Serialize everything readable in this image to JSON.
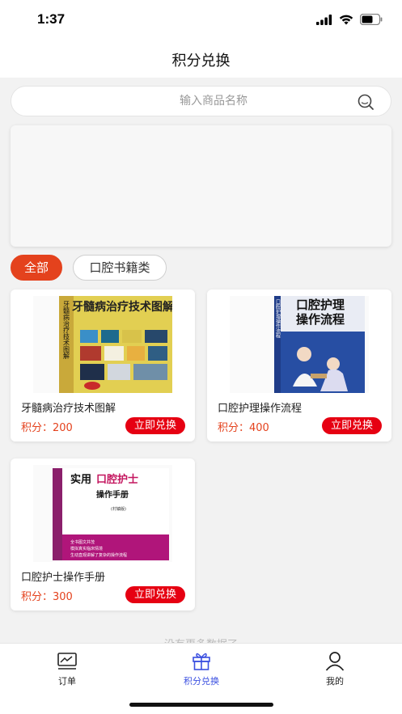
{
  "status_bar": {
    "time": "1:37"
  },
  "nav": {
    "title": "积分兑换"
  },
  "search": {
    "placeholder": "输入商品名称"
  },
  "categories": [
    {
      "label": "全部",
      "active": true
    },
    {
      "label": "口腔书籍类",
      "active": false
    }
  ],
  "products": [
    {
      "name": "牙髓病治疗技术图解",
      "points": "积分：200",
      "button": "立即兑换",
      "cover_title": "牙髓病治疗技术图解",
      "cover_spine": "牙髓病治疗技术图解"
    },
    {
      "name": "口腔护理操作流程",
      "points": "积分：400",
      "button": "立即兑换",
      "cover_title_line1": "口腔护理",
      "cover_title_line2": "操作流程",
      "cover_spine": "口腔护理操作流程"
    },
    {
      "name": "口腔护士操作手册",
      "points": "积分：300",
      "button": "立即兑换",
      "cover_title_prefix": "实用",
      "cover_title_highlight": "口腔护士",
      "cover_subtitle": "操作手册",
      "cover_edition": "(村镇版)",
      "cover_bullets": [
        "全书图文并茂",
        "模拟真实临床情境",
        "生动直观讲解了复杂的操作流程"
      ]
    }
  ],
  "footer_note": "没有更多数据了",
  "tabs": [
    {
      "label": "订单",
      "icon": "order-icon",
      "active": false
    },
    {
      "label": "积分兑换",
      "icon": "gift-icon",
      "active": true
    },
    {
      "label": "我的",
      "icon": "profile-icon",
      "active": false
    }
  ],
  "colors": {
    "accent": "#e4421d",
    "button": "#e60012",
    "tab_active": "#3a4fe0"
  }
}
